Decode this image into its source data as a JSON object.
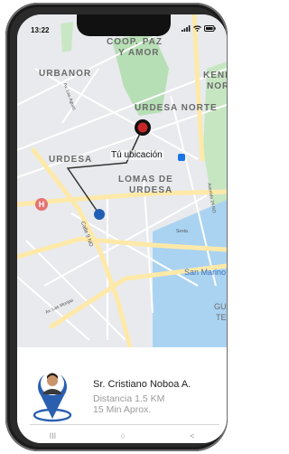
{
  "status_bar": {
    "time": "13:22"
  },
  "map": {
    "areas": {
      "coop_paz": "COOP. PAZ",
      "y_amor": "Y AMOR",
      "urbanor": "URBANOR",
      "kenn": "KENN",
      "nor": "NOR",
      "urdesa_norte": "URDESA NORTE",
      "urdesa": "URDESA",
      "lomas_de": "LOMAS DE",
      "urdesa_2": "URDESA",
      "san_marino": "San Marino",
      "gua": "GUA",
      "te": "TE"
    },
    "streets": {
      "av_las_aguas": "Av. Las Aguas",
      "calle_9_no": "Calle 9 NO",
      "sexta": "Sexta",
      "avenida_24_no": "Avenida 24 NO",
      "av_las_monjas": "Av. Las Monjas"
    },
    "current_location_label": "Tú ubicación",
    "poi_letter": "H"
  },
  "driver": {
    "name": "Sr. Cristiano Noboa A.",
    "distance": "Distancia 1.5 KM",
    "eta": "15 Min Aprox."
  },
  "colors": {
    "map_bg": "#e8eaed",
    "green": "#b7dfb5",
    "road_major": "#ffe9a8",
    "water": "#aad3f2",
    "marker_blue": "#1f5fb5",
    "label_blue": "#3b6fb6",
    "location_red": "#c62828"
  },
  "nav_bar": {
    "recents": "III",
    "home": "○",
    "back": "<"
  }
}
